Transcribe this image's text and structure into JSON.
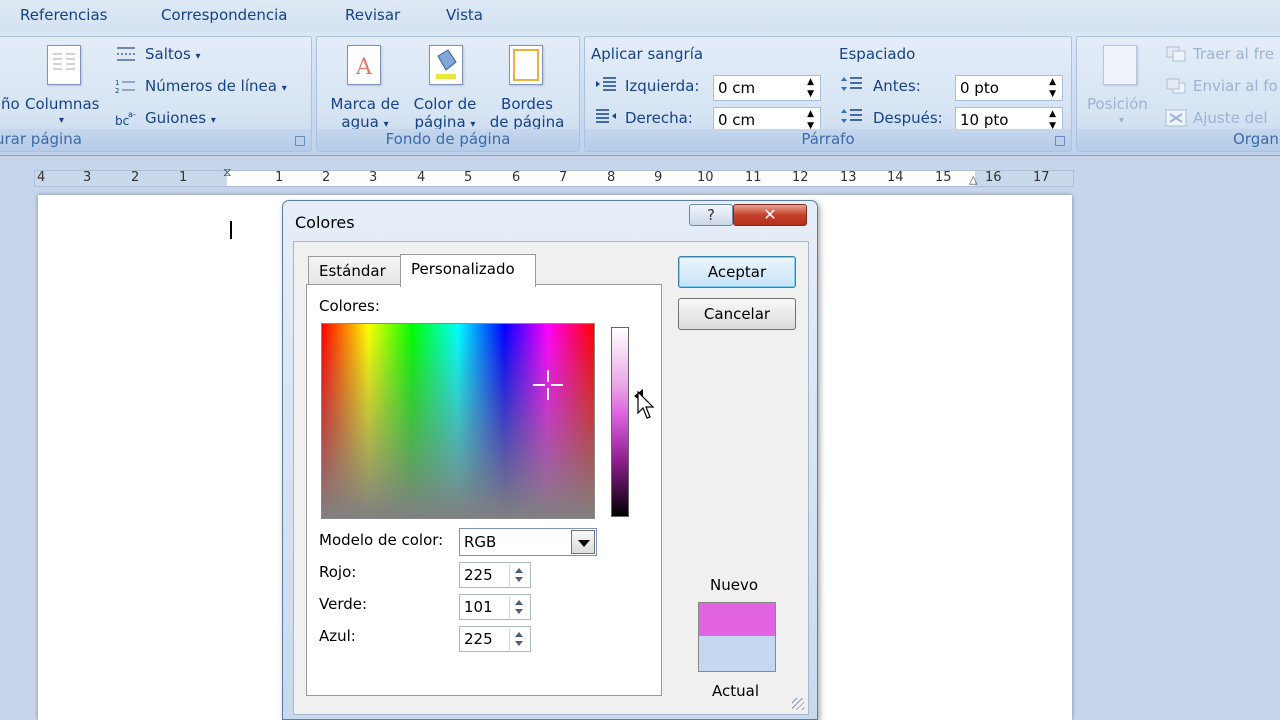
{
  "ribbon_tabs": [
    "Referencias",
    "Correspondencia",
    "Revisar",
    "Vista"
  ],
  "page_setup": {
    "partial_left": "ño",
    "columnas": "Columnas",
    "saltos": "Saltos",
    "numeros_linea": "Números de línea",
    "guiones": "Guiones",
    "label": "urar página"
  },
  "page_bg": {
    "marca_agua_1": "Marca de",
    "marca_agua_2": "agua",
    "color_pagina_1": "Color de",
    "color_pagina_2": "página",
    "bordes_1": "Bordes",
    "bordes_2": "de página",
    "label": "Fondo de página"
  },
  "paragraph": {
    "indent_title": "Aplicar sangría",
    "izquierda_label": "Izquierda:",
    "izquierda_value": "0 cm",
    "derecha_label": "Derecha:",
    "derecha_value": "0 cm",
    "spacing_title": "Espaciado",
    "antes_label": "Antes:",
    "antes_value": "0 pto",
    "despues_label": "Después:",
    "despues_value": "10 pto",
    "label": "Párrafo"
  },
  "arrange": {
    "posicion": "Posición",
    "traer": "Traer al fre",
    "enviar": "Enviar al fo",
    "ajuste": "Ajuste del",
    "label": "Organ"
  },
  "ruler": {
    "left_numbers": [
      "4",
      "3",
      "2",
      "1"
    ],
    "right_numbers": [
      "1",
      "2",
      "3",
      "4",
      "5",
      "6",
      "7",
      "8",
      "9",
      "10",
      "11",
      "12",
      "13",
      "14",
      "15",
      "16",
      "17"
    ]
  },
  "dialog": {
    "title": "Colores",
    "help_label": "?",
    "close_label": "✕",
    "tab_standard": "Estándar",
    "tab_custom": "Personalizado",
    "colors_label": "Colores:",
    "model_label": "Modelo de color:",
    "model_value": "RGB",
    "red_label": "Rojo:",
    "red_value": "225",
    "green_label": "Verde:",
    "green_value": "101",
    "blue_label": "Azul:",
    "blue_value": "225",
    "accept": "Aceptar",
    "cancel": "Cancelar",
    "new_label": "Nuevo",
    "current_label": "Actual",
    "new_color": "#e165e1",
    "current_color": "#c5d8f1"
  }
}
